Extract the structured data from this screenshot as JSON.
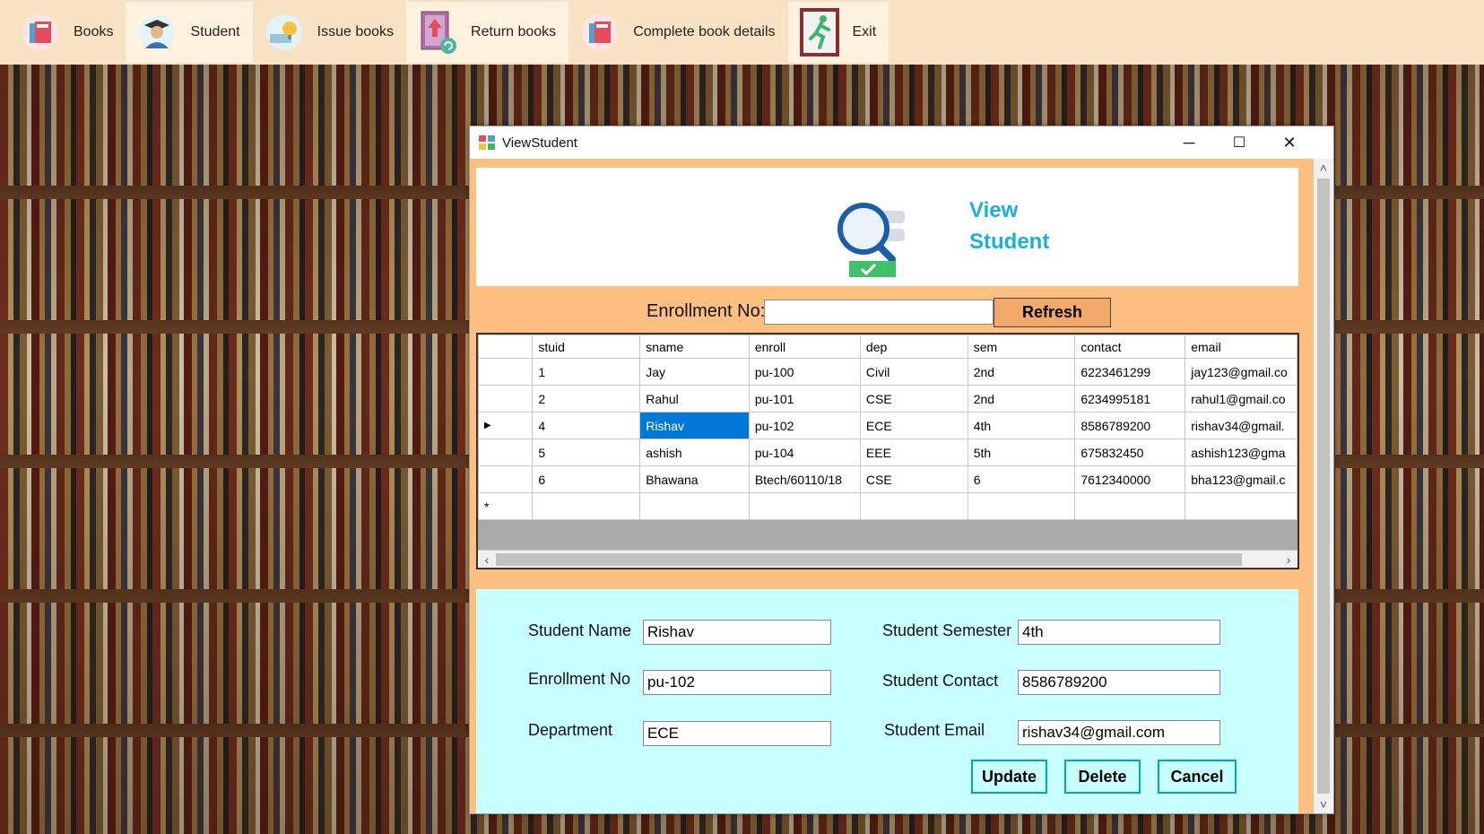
{
  "toolbar": {
    "items": [
      {
        "label": "Books",
        "icon": "books-icon"
      },
      {
        "label": "Student",
        "icon": "student-icon"
      },
      {
        "label": "Issue books",
        "icon": "issue-books-icon"
      },
      {
        "label": "Return books",
        "icon": "return-books-icon"
      },
      {
        "label": "Complete book details",
        "icon": "book-details-icon"
      },
      {
        "label": "Exit",
        "icon": "exit-icon"
      }
    ]
  },
  "window": {
    "title": "ViewStudent",
    "minimize": "─",
    "maximize": "☐",
    "close": "✕"
  },
  "header": {
    "line1": "View",
    "line2": "Student"
  },
  "search": {
    "label": "Enrollment No:",
    "value": "",
    "refresh": "Refresh"
  },
  "grid": {
    "columns": [
      "stuid",
      "sname",
      "enroll",
      "dep",
      "sem",
      "contact",
      "email"
    ],
    "rows": [
      [
        "1",
        "Jay",
        "pu-100",
        "Civil",
        "2nd",
        "6223461299",
        "jay123@gmail.co"
      ],
      [
        "2",
        "Rahul",
        "pu-101",
        "CSE",
        "2nd",
        "6234995181",
        "rahul1@gmail.co"
      ],
      [
        "4",
        "Rishav",
        "pu-102",
        "ECE",
        "4th",
        "8586789200",
        "rishav34@gmail."
      ],
      [
        "5",
        "ashish",
        "pu-104",
        "EEE",
        "5th",
        "675832450",
        "ashish123@gma"
      ],
      [
        "6",
        "Bhawana",
        "Btech/60110/18",
        "CSE",
        "6",
        "7612340000",
        "bha123@gmail.c"
      ]
    ],
    "selected_row": 2,
    "current_row_marker": "▶",
    "new_row_marker": "*"
  },
  "details": {
    "name_label": "Student Name",
    "name_value": "Rishav",
    "enroll_label": "Enrollment No",
    "enroll_value": "pu-102",
    "dep_label": "Department",
    "dep_value": "ECE",
    "sem_label": "Student Semester",
    "sem_value": "4th",
    "contact_label": "Student Contact",
    "contact_value": "8586789200",
    "email_label": "Student Email",
    "email_value": "rishav34@gmail.com",
    "update": "Update",
    "delete": "Delete",
    "cancel": "Cancel"
  },
  "colors": {
    "accent": "#1ab0d8",
    "panel": "#ffbf80",
    "details_bg": "#c8ffff",
    "selection": "#0078d7"
  }
}
